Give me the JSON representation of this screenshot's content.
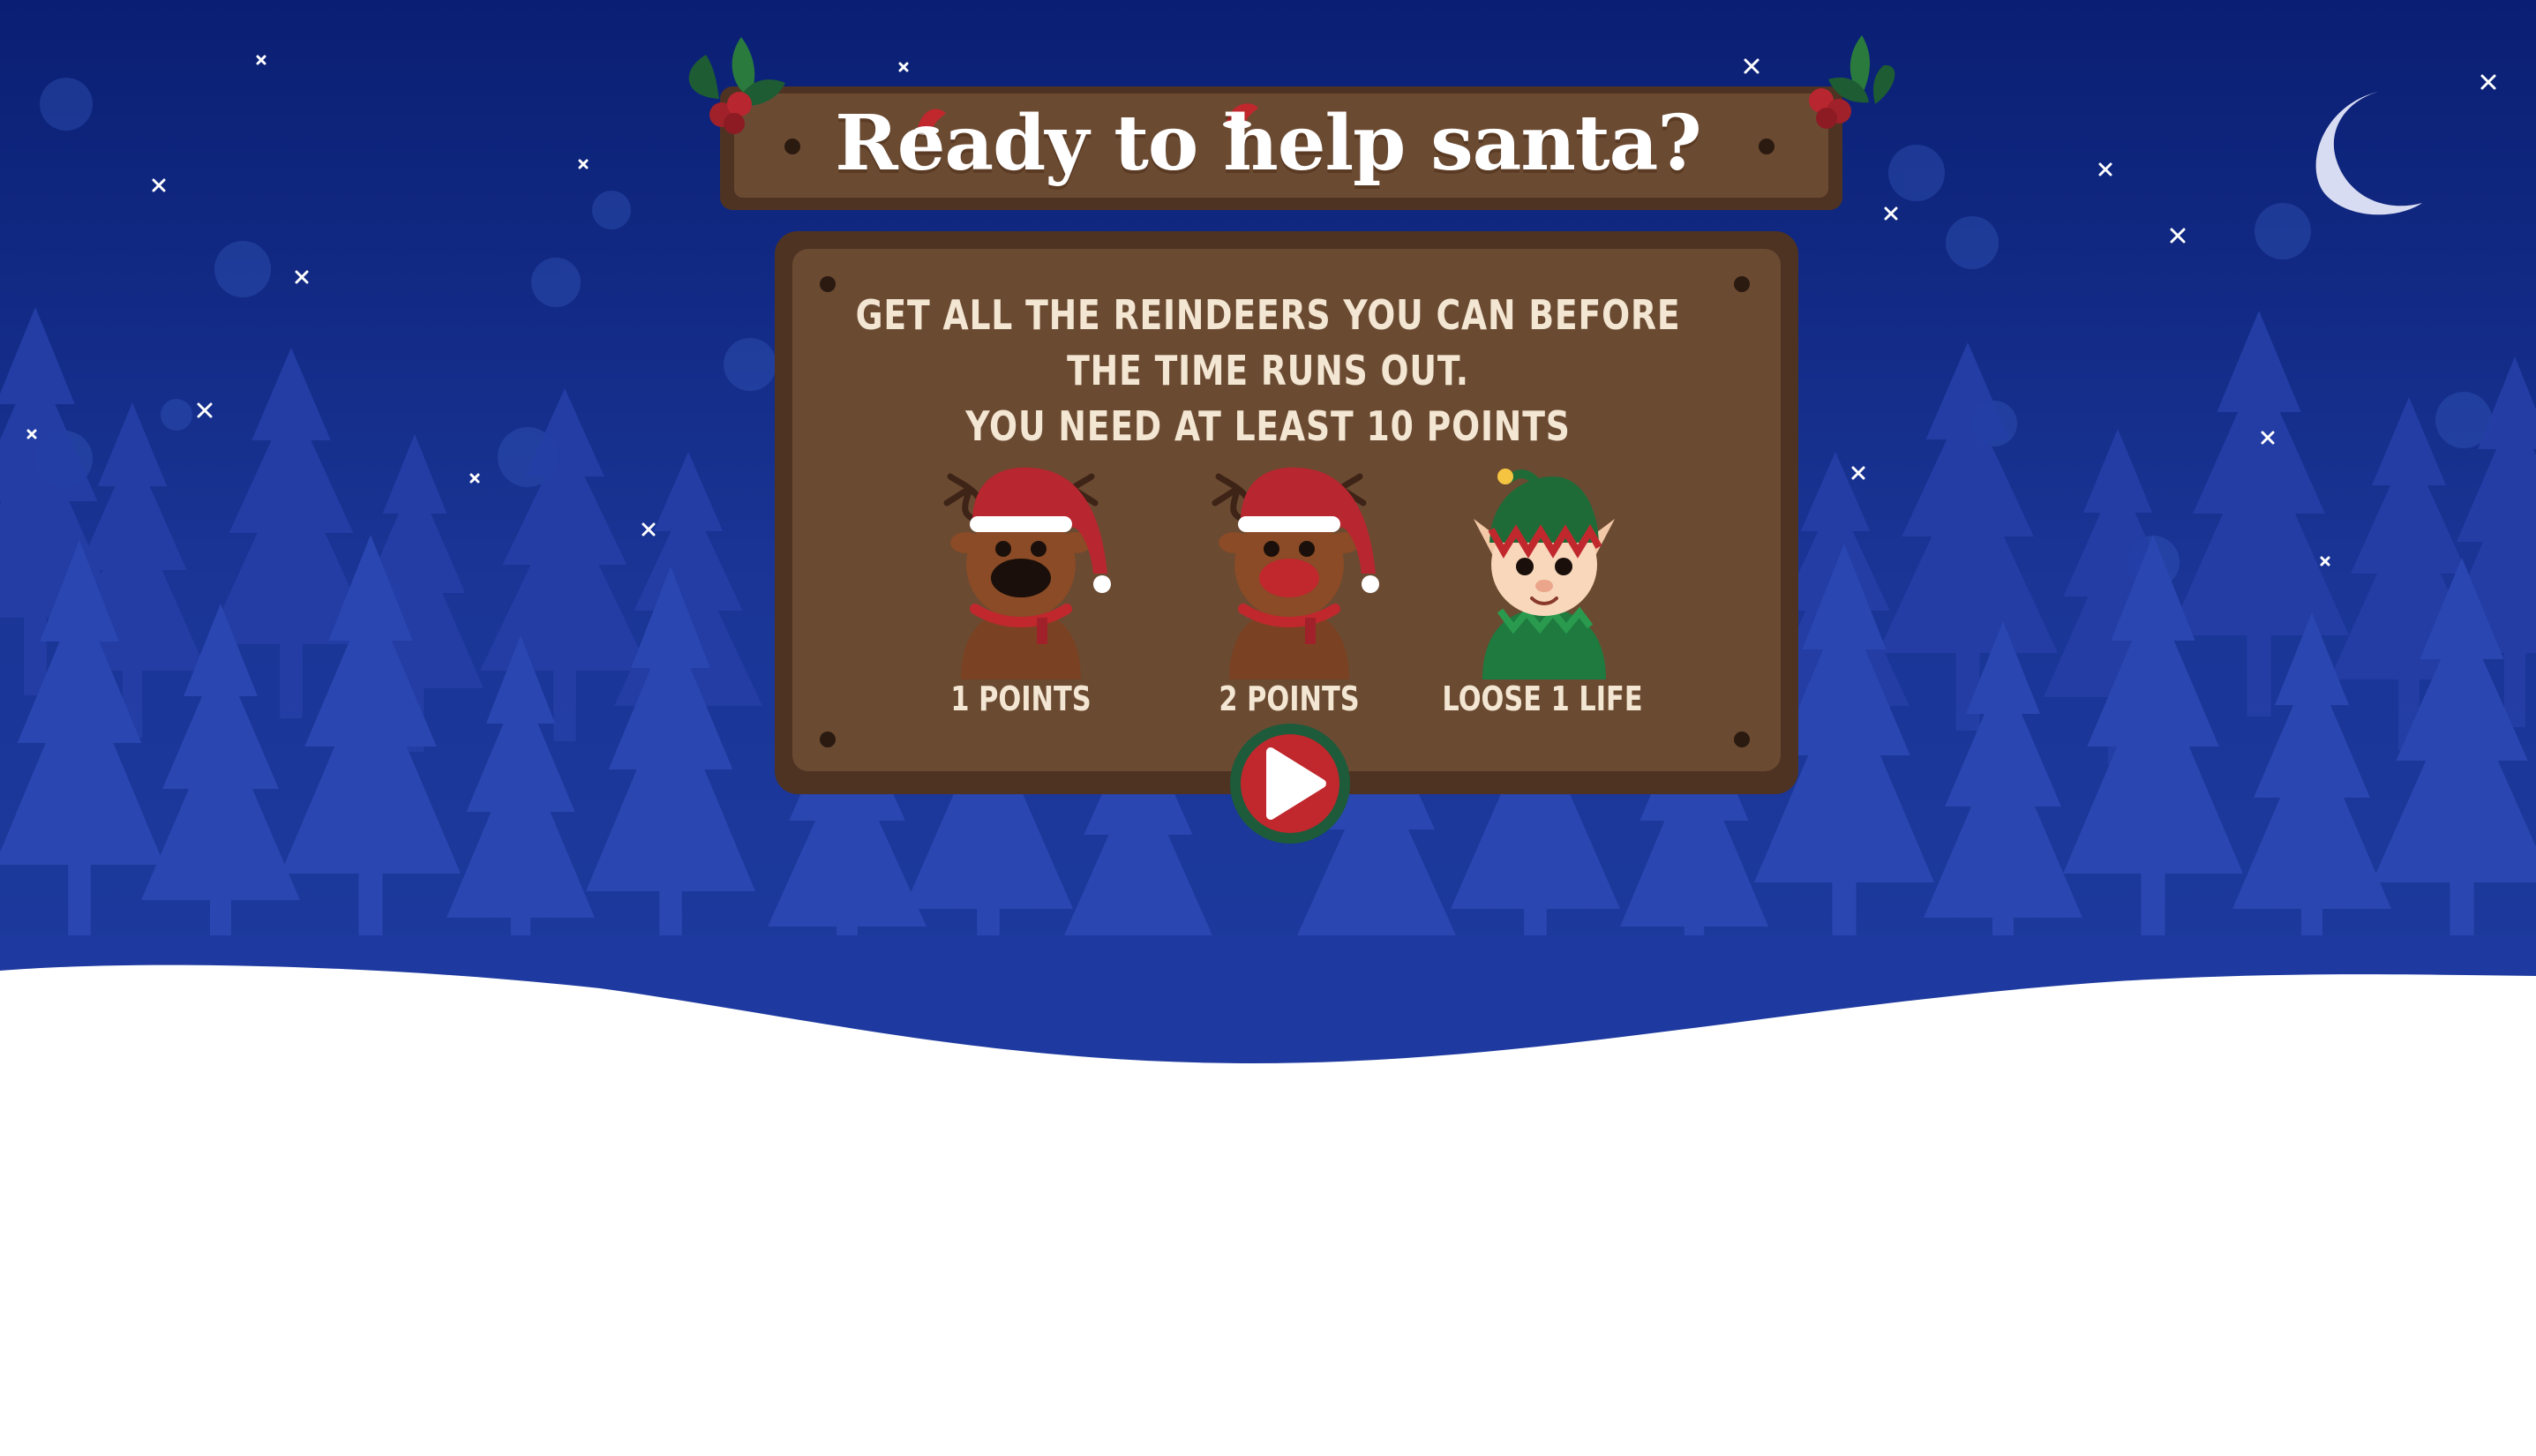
{
  "title": "Ready to help santa?",
  "instructions": [
    "GET ALL THE REINDEERS YOU CAN BEFORE",
    "THE TIME RUNS OUT.",
    "YOU NEED AT LEAST 10 POINTS"
  ],
  "items": [
    {
      "icon": "brown-reindeer-icon",
      "label": "1 POINTS"
    },
    {
      "icon": "red-nose-reindeer-icon",
      "label": "2 POINTS"
    },
    {
      "icon": "elf-icon",
      "label": "LOOSE 1 LIFE"
    }
  ],
  "play_button": {
    "icon": "play-icon"
  },
  "colors": {
    "sky_top": "#0a1f6e",
    "sky_bottom": "#1c3fa8",
    "wood": "#6b4a32",
    "wood_dark": "#4f3522",
    "play_red": "#c0282d",
    "play_ring": "#1d5b3a",
    "snow": "#ffffff"
  }
}
